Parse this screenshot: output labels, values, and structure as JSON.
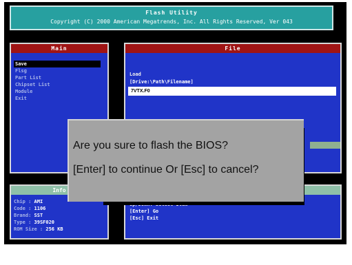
{
  "header": {
    "title": "Flash Utility",
    "copyright": "Copyright (C) 2000 American Megatrends, Inc. All Rights Reserved, Ver 043"
  },
  "main_panel": {
    "title": "Main",
    "items": [
      {
        "label": "Save",
        "selected": true
      },
      {
        "label": "Flsg",
        "selected": false
      },
      {
        "label": "Part List",
        "selected": false
      },
      {
        "label": "Chipset List",
        "selected": false
      },
      {
        "label": "Module",
        "selected": false
      },
      {
        "label": "Exit",
        "selected": false
      }
    ]
  },
  "file_panel": {
    "title": "File",
    "label": "Load",
    "path_hint": "[Drive:\\Path\\Filename]",
    "input_value": "7VTX.F0"
  },
  "info_panel": {
    "title": "Info",
    "items": [
      {
        "key": "Chip : ",
        "value": "AMI"
      },
      {
        "key": "Code : ",
        "value": "1106"
      },
      {
        "key": "Brand: ",
        "value": "SST"
      },
      {
        "key": "Type : ",
        "value": "39SF020"
      },
      {
        "key": "ROM Size : ",
        "value": "256 KB"
      }
    ]
  },
  "right_panel": {
    "keys": [
      "Up/Down: Select Item",
      "[Enter] Go",
      "[Esc] Exit"
    ]
  },
  "dialog": {
    "line1": "Are you sure to flash the BIOS?",
    "line2": "[Enter] to continue Or [Esc] to cancel?"
  },
  "colors": {
    "panel_bg": "#2034c8",
    "panel_title_bg": "#a01414",
    "header_bg": "#27a0a0",
    "dialog_bg": "#a3a3a3"
  }
}
